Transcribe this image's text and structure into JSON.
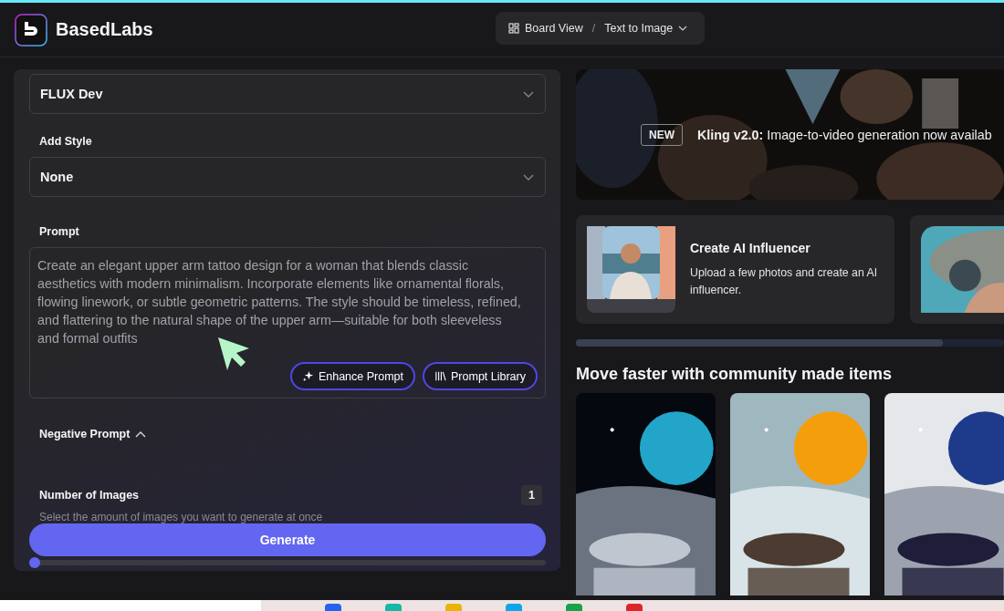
{
  "brand": {
    "name": "BasedLabs"
  },
  "breadcrumb": {
    "separator": "/",
    "items": [
      {
        "label": "Board View",
        "kind": "view"
      },
      {
        "label": "Text to Image",
        "kind": "dropdown"
      }
    ]
  },
  "form": {
    "model": {
      "value": "FLUX Dev"
    },
    "style": {
      "label": "Add Style",
      "value": "None"
    },
    "prompt": {
      "label": "Prompt",
      "value": "Create an elegant upper arm tattoo design for a woman that blends classic aesthetics with modern minimalism. Incorporate elements like ornamental florals, flowing linework, or subtle geometric patterns. The style should be timeless, refined, and flattering to the natural shape of the upper arm—suitable for both sleeveless and formal outfits",
      "buttons": [
        {
          "label": "Enhance Prompt",
          "kind": "enhance"
        },
        {
          "label": "Prompt Library",
          "kind": "library"
        }
      ]
    },
    "negative_prompt": {
      "label": "Negative Prompt",
      "expanded": true
    },
    "number_of_images": {
      "label": "Number of Images",
      "value": "1",
      "hint": "Select the amount of images you want to generate at once",
      "level": 0
    },
    "generate": {
      "label": "Generate"
    }
  },
  "banner": {
    "badge": "NEW",
    "text": "**Kling v2.0:** Image-to-video generation now availab"
  },
  "feature_cards": [
    {
      "kind": "feature",
      "title": "Create AI Influencer",
      "text": "Upload a few photos and create an AI influencer."
    },
    {
      "kind": "picture"
    }
  ],
  "section": {
    "title": "Move faster with community made items"
  },
  "community_items": [
    {
      "kind": "picture"
    },
    {
      "kind": "picture"
    },
    {
      "kind": "picture"
    }
  ]
}
